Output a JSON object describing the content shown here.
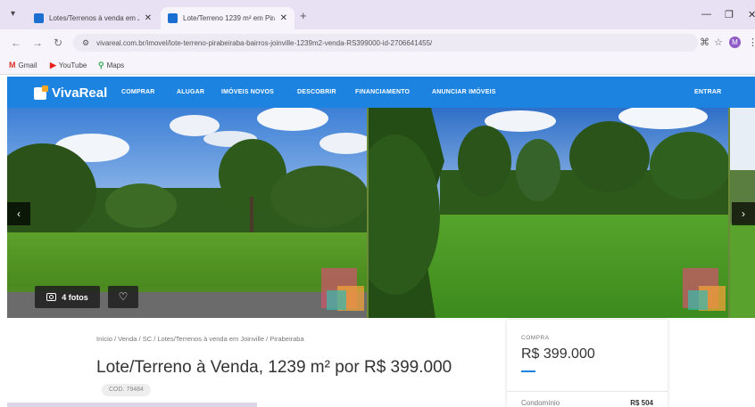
{
  "browser": {
    "tabs": [
      {
        "title": "Lotes/Terrenos à venda em Joi..."
      },
      {
        "title": "Lote/Terreno 1239 m² em Pira..."
      }
    ],
    "tab_close": "✕",
    "new_tab": "+",
    "url": "vivareal.com.br/imovel/lote-terreno-pirabeiraba-bairros-joinville-1239m2-venda-RS399000-id-2706641455/",
    "profile_initial": "M",
    "bookmarks": [
      {
        "label": "Gmail"
      },
      {
        "label": "YouTube"
      },
      {
        "label": "Maps"
      }
    ]
  },
  "site": {
    "brand": "VivaReal",
    "nav": [
      "COMPRAR",
      "ALUGAR",
      "IMÓVEIS NOVOS",
      "DESCOBRIR",
      "FINANCIAMENTO",
      "ANUNCIAR IMÓVEIS"
    ],
    "login": "ENTRAR",
    "brand_color": "#1c83e0"
  },
  "gallery": {
    "photos_label": "4 fotos",
    "prev": "‹",
    "next": "›"
  },
  "listing": {
    "breadcrumb": "Início / Venda / SC / Lotes/Terrenos à venda em Joinville / Pirabeiraba",
    "title": "Lote/Terreno à Venda, 1239 m² por R$ 399.000",
    "code": "COD. 79484"
  },
  "price_card": {
    "label": "COMPRA",
    "price": "R$ 399.000",
    "condo_label": "Condomínio",
    "condo_value": "R$ 504"
  }
}
